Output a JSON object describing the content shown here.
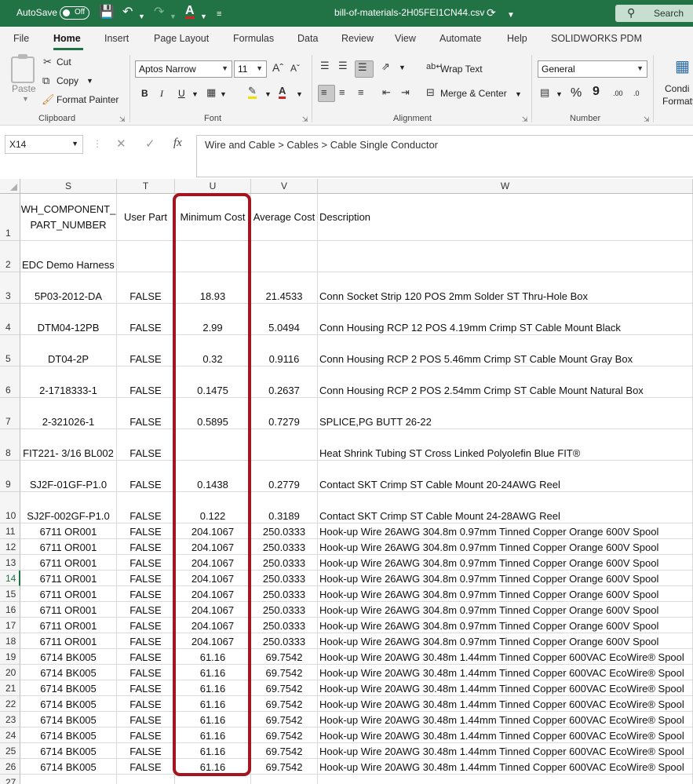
{
  "titlebar": {
    "autosave_label": "AutoSave",
    "autosave_state": "Off",
    "file_name": "bill-of-materials-2H05FEI1CN44.csv",
    "search_label": "Search"
  },
  "tabs": [
    "File",
    "Home",
    "Insert",
    "Page Layout",
    "Formulas",
    "Data",
    "Review",
    "View",
    "Automate",
    "Help",
    "SOLIDWORKS PDM"
  ],
  "active_tab": "Home",
  "ribbon": {
    "clipboard": {
      "label": "Clipboard",
      "paste": "Paste",
      "cut": "Cut",
      "copy": "Copy",
      "format_painter": "Format Painter"
    },
    "font": {
      "label": "Font",
      "family": "Aptos Narrow",
      "size": "11",
      "bold": "B",
      "italic": "I",
      "underline": "U"
    },
    "alignment": {
      "label": "Alignment",
      "wrap_text": "Wrap Text",
      "merge_center": "Merge & Center"
    },
    "number": {
      "label": "Number",
      "format": "General",
      "percent": "%",
      "comma": "9",
      "increase_decimal": ".00",
      "decrease_decimal": ".0"
    },
    "conditional": {
      "label_line1": "Condi",
      "label_line2": "Formatt"
    }
  },
  "formula_bar": {
    "name_box": "X14",
    "formula": "Wire and Cable > Cables > Cable Single Conductor"
  },
  "columns": [
    "S",
    "T",
    "U",
    "V",
    "W"
  ],
  "header_row": {
    "row_number": "1",
    "s_line1": "WH_COMPONENT_",
    "s_line2": "PART_NUMBER",
    "t": "User Part",
    "u": "Minimum Cost",
    "v": "Average Cost",
    "w": "Description"
  },
  "rows": [
    {
      "n": "2",
      "s": "EDC Demo Harness",
      "t": "",
      "u": "",
      "v": "",
      "w": ""
    },
    {
      "n": "3",
      "s": "5P03-2012-DA",
      "t": "FALSE",
      "u": "18.93",
      "v": "21.4533",
      "w": "Conn Socket Strip 120 POS 2mm Solder ST Thru-Hole Box"
    },
    {
      "n": "4",
      "s": "DTM04-12PB",
      "t": "FALSE",
      "u": "2.99",
      "v": "5.0494",
      "w": "Conn Housing RCP 12 POS 4.19mm Crimp ST Cable Mount Black"
    },
    {
      "n": "5",
      "s": "DT04-2P",
      "t": "FALSE",
      "u": "0.32",
      "v": "0.9116",
      "w": "Conn Housing RCP 2 POS 5.46mm Crimp ST Cable Mount Gray Box"
    },
    {
      "n": "6",
      "s": "2-1718333-1",
      "t": "FALSE",
      "u": "0.1475",
      "v": "0.2637",
      "w": "Conn Housing RCP 2 POS 2.54mm Crimp ST Cable Mount Natural Box"
    },
    {
      "n": "7",
      "s": "2-321026-1",
      "t": "FALSE",
      "u": "0.5895",
      "v": "0.7279",
      "w": "SPLICE,PG BUTT 26-22"
    },
    {
      "n": "8",
      "s": "FIT221- 3/16 BL002",
      "t": "FALSE",
      "u": "",
      "v": "",
      "w": "Heat Shrink Tubing ST Cross Linked Polyolefin Blue FIT®"
    },
    {
      "n": "9",
      "s": "SJ2F-01GF-P1.0",
      "t": "FALSE",
      "u": "0.1438",
      "v": "0.2779",
      "w": "Contact SKT Crimp ST Cable Mount 20-24AWG Reel"
    },
    {
      "n": "10",
      "s": "SJ2F-002GF-P1.0",
      "t": "FALSE",
      "u": "0.122",
      "v": "0.3189",
      "w": "Contact SKT Crimp ST Cable Mount 24-28AWG Reel"
    },
    {
      "n": "11",
      "s": "6711 OR001",
      "t": "FALSE",
      "u": "204.1067",
      "v": "250.0333",
      "w": "Hook-up Wire 26AWG 304.8m 0.97mm Tinned Copper Orange 600V Spool"
    },
    {
      "n": "12",
      "s": "6711 OR001",
      "t": "FALSE",
      "u": "204.1067",
      "v": "250.0333",
      "w": "Hook-up Wire 26AWG 304.8m 0.97mm Tinned Copper Orange 600V Spool"
    },
    {
      "n": "13",
      "s": "6711 OR001",
      "t": "FALSE",
      "u": "204.1067",
      "v": "250.0333",
      "w": "Hook-up Wire 26AWG 304.8m 0.97mm Tinned Copper Orange 600V Spool"
    },
    {
      "n": "14",
      "s": "6711 OR001",
      "t": "FALSE",
      "u": "204.1067",
      "v": "250.0333",
      "w": "Hook-up Wire 26AWG 304.8m 0.97mm Tinned Copper Orange 600V Spool"
    },
    {
      "n": "15",
      "s": "6711 OR001",
      "t": "FALSE",
      "u": "204.1067",
      "v": "250.0333",
      "w": "Hook-up Wire 26AWG 304.8m 0.97mm Tinned Copper Orange 600V Spool"
    },
    {
      "n": "16",
      "s": "6711 OR001",
      "t": "FALSE",
      "u": "204.1067",
      "v": "250.0333",
      "w": "Hook-up Wire 26AWG 304.8m 0.97mm Tinned Copper Orange 600V Spool"
    },
    {
      "n": "17",
      "s": "6711 OR001",
      "t": "FALSE",
      "u": "204.1067",
      "v": "250.0333",
      "w": "Hook-up Wire 26AWG 304.8m 0.97mm Tinned Copper Orange 600V Spool"
    },
    {
      "n": "18",
      "s": "6711 OR001",
      "t": "FALSE",
      "u": "204.1067",
      "v": "250.0333",
      "w": "Hook-up Wire 26AWG 304.8m 0.97mm Tinned Copper Orange 600V Spool"
    },
    {
      "n": "19",
      "s": "6714 BK005",
      "t": "FALSE",
      "u": "61.16",
      "v": "69.7542",
      "w": "Hook-up Wire 20AWG 30.48m 1.44mm Tinned Copper 600VAC EcoWire® Spool"
    },
    {
      "n": "20",
      "s": "6714 BK005",
      "t": "FALSE",
      "u": "61.16",
      "v": "69.7542",
      "w": "Hook-up Wire 20AWG 30.48m 1.44mm Tinned Copper 600VAC EcoWire® Spool"
    },
    {
      "n": "21",
      "s": "6714 BK005",
      "t": "FALSE",
      "u": "61.16",
      "v": "69.7542",
      "w": "Hook-up Wire 20AWG 30.48m 1.44mm Tinned Copper 600VAC EcoWire® Spool"
    },
    {
      "n": "22",
      "s": "6714 BK005",
      "t": "FALSE",
      "u": "61.16",
      "v": "69.7542",
      "w": "Hook-up Wire 20AWG 30.48m 1.44mm Tinned Copper 600VAC EcoWire® Spool"
    },
    {
      "n": "23",
      "s": "6714 BK005",
      "t": "FALSE",
      "u": "61.16",
      "v": "69.7542",
      "w": "Hook-up Wire 20AWG 30.48m 1.44mm Tinned Copper 600VAC EcoWire® Spool"
    },
    {
      "n": "24",
      "s": "6714 BK005",
      "t": "FALSE",
      "u": "61.16",
      "v": "69.7542",
      "w": "Hook-up Wire 20AWG 30.48m 1.44mm Tinned Copper 600VAC EcoWire® Spool"
    },
    {
      "n": "25",
      "s": "6714 BK005",
      "t": "FALSE",
      "u": "61.16",
      "v": "69.7542",
      "w": "Hook-up Wire 20AWG 30.48m 1.44mm Tinned Copper 600VAC EcoWire® Spool"
    },
    {
      "n": "26",
      "s": "6714 BK005",
      "t": "FALSE",
      "u": "61.16",
      "v": "69.7542",
      "w": "Hook-up Wire 20AWG 30.48m 1.44mm Tinned Copper 600VAC EcoWire® Spool"
    },
    {
      "n": "27",
      "s": "",
      "t": "",
      "u": "",
      "v": "",
      "w": ""
    }
  ],
  "selected_row": "14",
  "colors": {
    "excel_green": "#217346",
    "highlight_red": "#a31520"
  }
}
